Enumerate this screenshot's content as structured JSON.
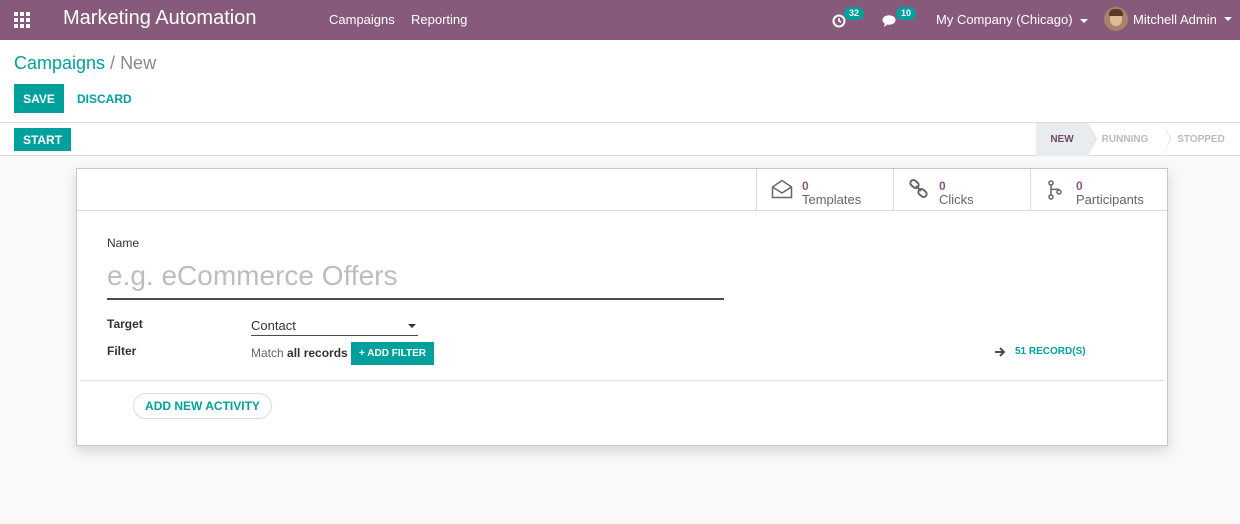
{
  "navbar": {
    "app_name": "Marketing Automation",
    "menu": [
      "Campaigns",
      "Reporting"
    ],
    "activity_count": "32",
    "message_count": "10",
    "company": "My Company (Chicago)",
    "user": "Mitchell Admin",
    "bg_color": "#875a7b"
  },
  "control": {
    "breadcrumb_root": "Campaigns",
    "breadcrumb_sep": "/",
    "breadcrumb_current": "New",
    "save_label": "SAVE",
    "discard_label": "DISCARD"
  },
  "statusbar": {
    "start_label": "START",
    "stages": [
      "NEW",
      "RUNNING",
      "STOPPED"
    ],
    "active_stage": "NEW"
  },
  "stats": [
    {
      "icon": "envelope-open-icon",
      "value": "0",
      "label": "Templates"
    },
    {
      "icon": "link-icon",
      "value": "0",
      "label": "Clicks"
    },
    {
      "icon": "code-fork-icon",
      "value": "0",
      "label": "Participants"
    }
  ],
  "form": {
    "name_label": "Name",
    "name_placeholder": "e.g. eCommerce Offers",
    "target_label": "Target",
    "target_value": "Contact",
    "filter_label": "Filter",
    "filter_prefix": "Match",
    "filter_bold": "all records",
    "add_filter_label": "+ ADD FILTER",
    "records_label": "51 RECORD(S)",
    "add_activity_label": "ADD NEW ACTIVITY"
  },
  "accent_color": "#00a09d"
}
